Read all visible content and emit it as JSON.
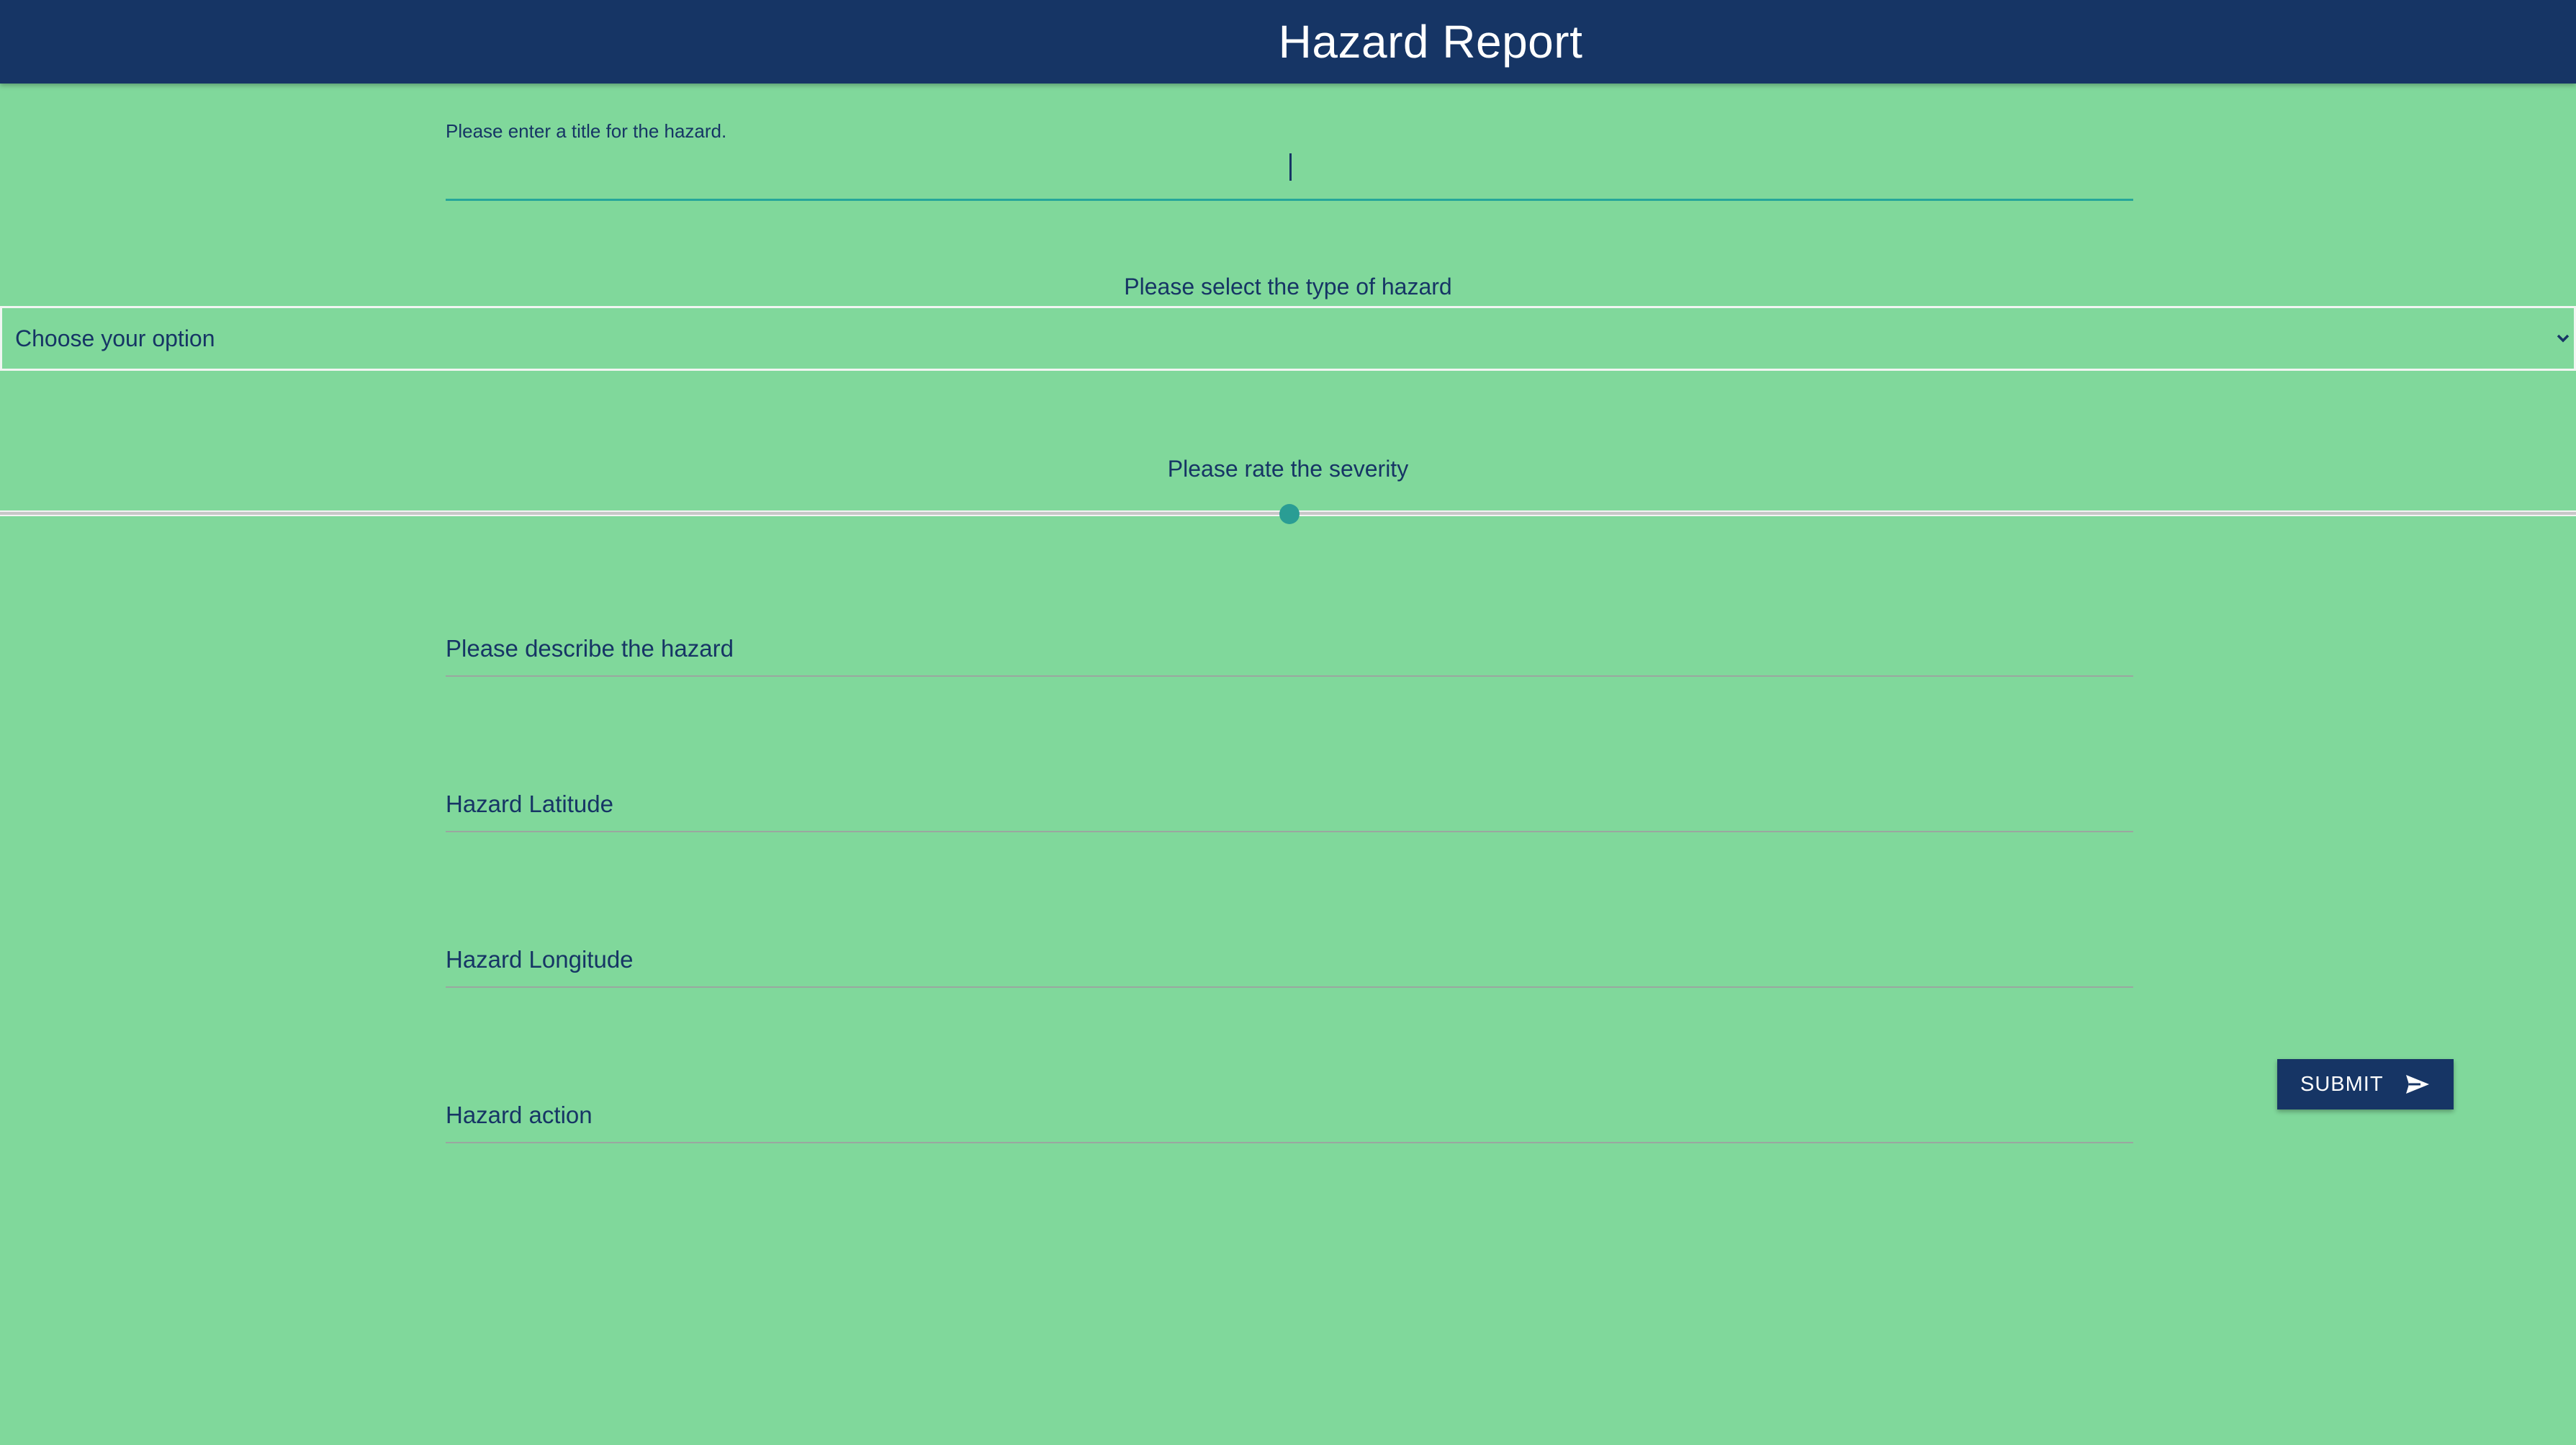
{
  "header": {
    "title": "Hazard Report"
  },
  "form": {
    "title_field": {
      "label": "Please enter a title for the hazard.",
      "value": ""
    },
    "type_select": {
      "label": "Please select the type of hazard",
      "selected": "Choose your option"
    },
    "severity": {
      "label": "Please rate the severity",
      "value_fraction": 0.5
    },
    "description": {
      "placeholder": "Please describe the hazard"
    },
    "latitude": {
      "placeholder": "Hazard Latitude"
    },
    "longitude": {
      "placeholder": "Hazard Longitude"
    },
    "action": {
      "placeholder": "Hazard action"
    },
    "submit": {
      "label": "SUBMIT",
      "icon": "send-icon"
    }
  },
  "colors": {
    "page_background": "#80d89b",
    "header_background": "#163565",
    "text": "#163565",
    "accent": "#26a69a"
  }
}
